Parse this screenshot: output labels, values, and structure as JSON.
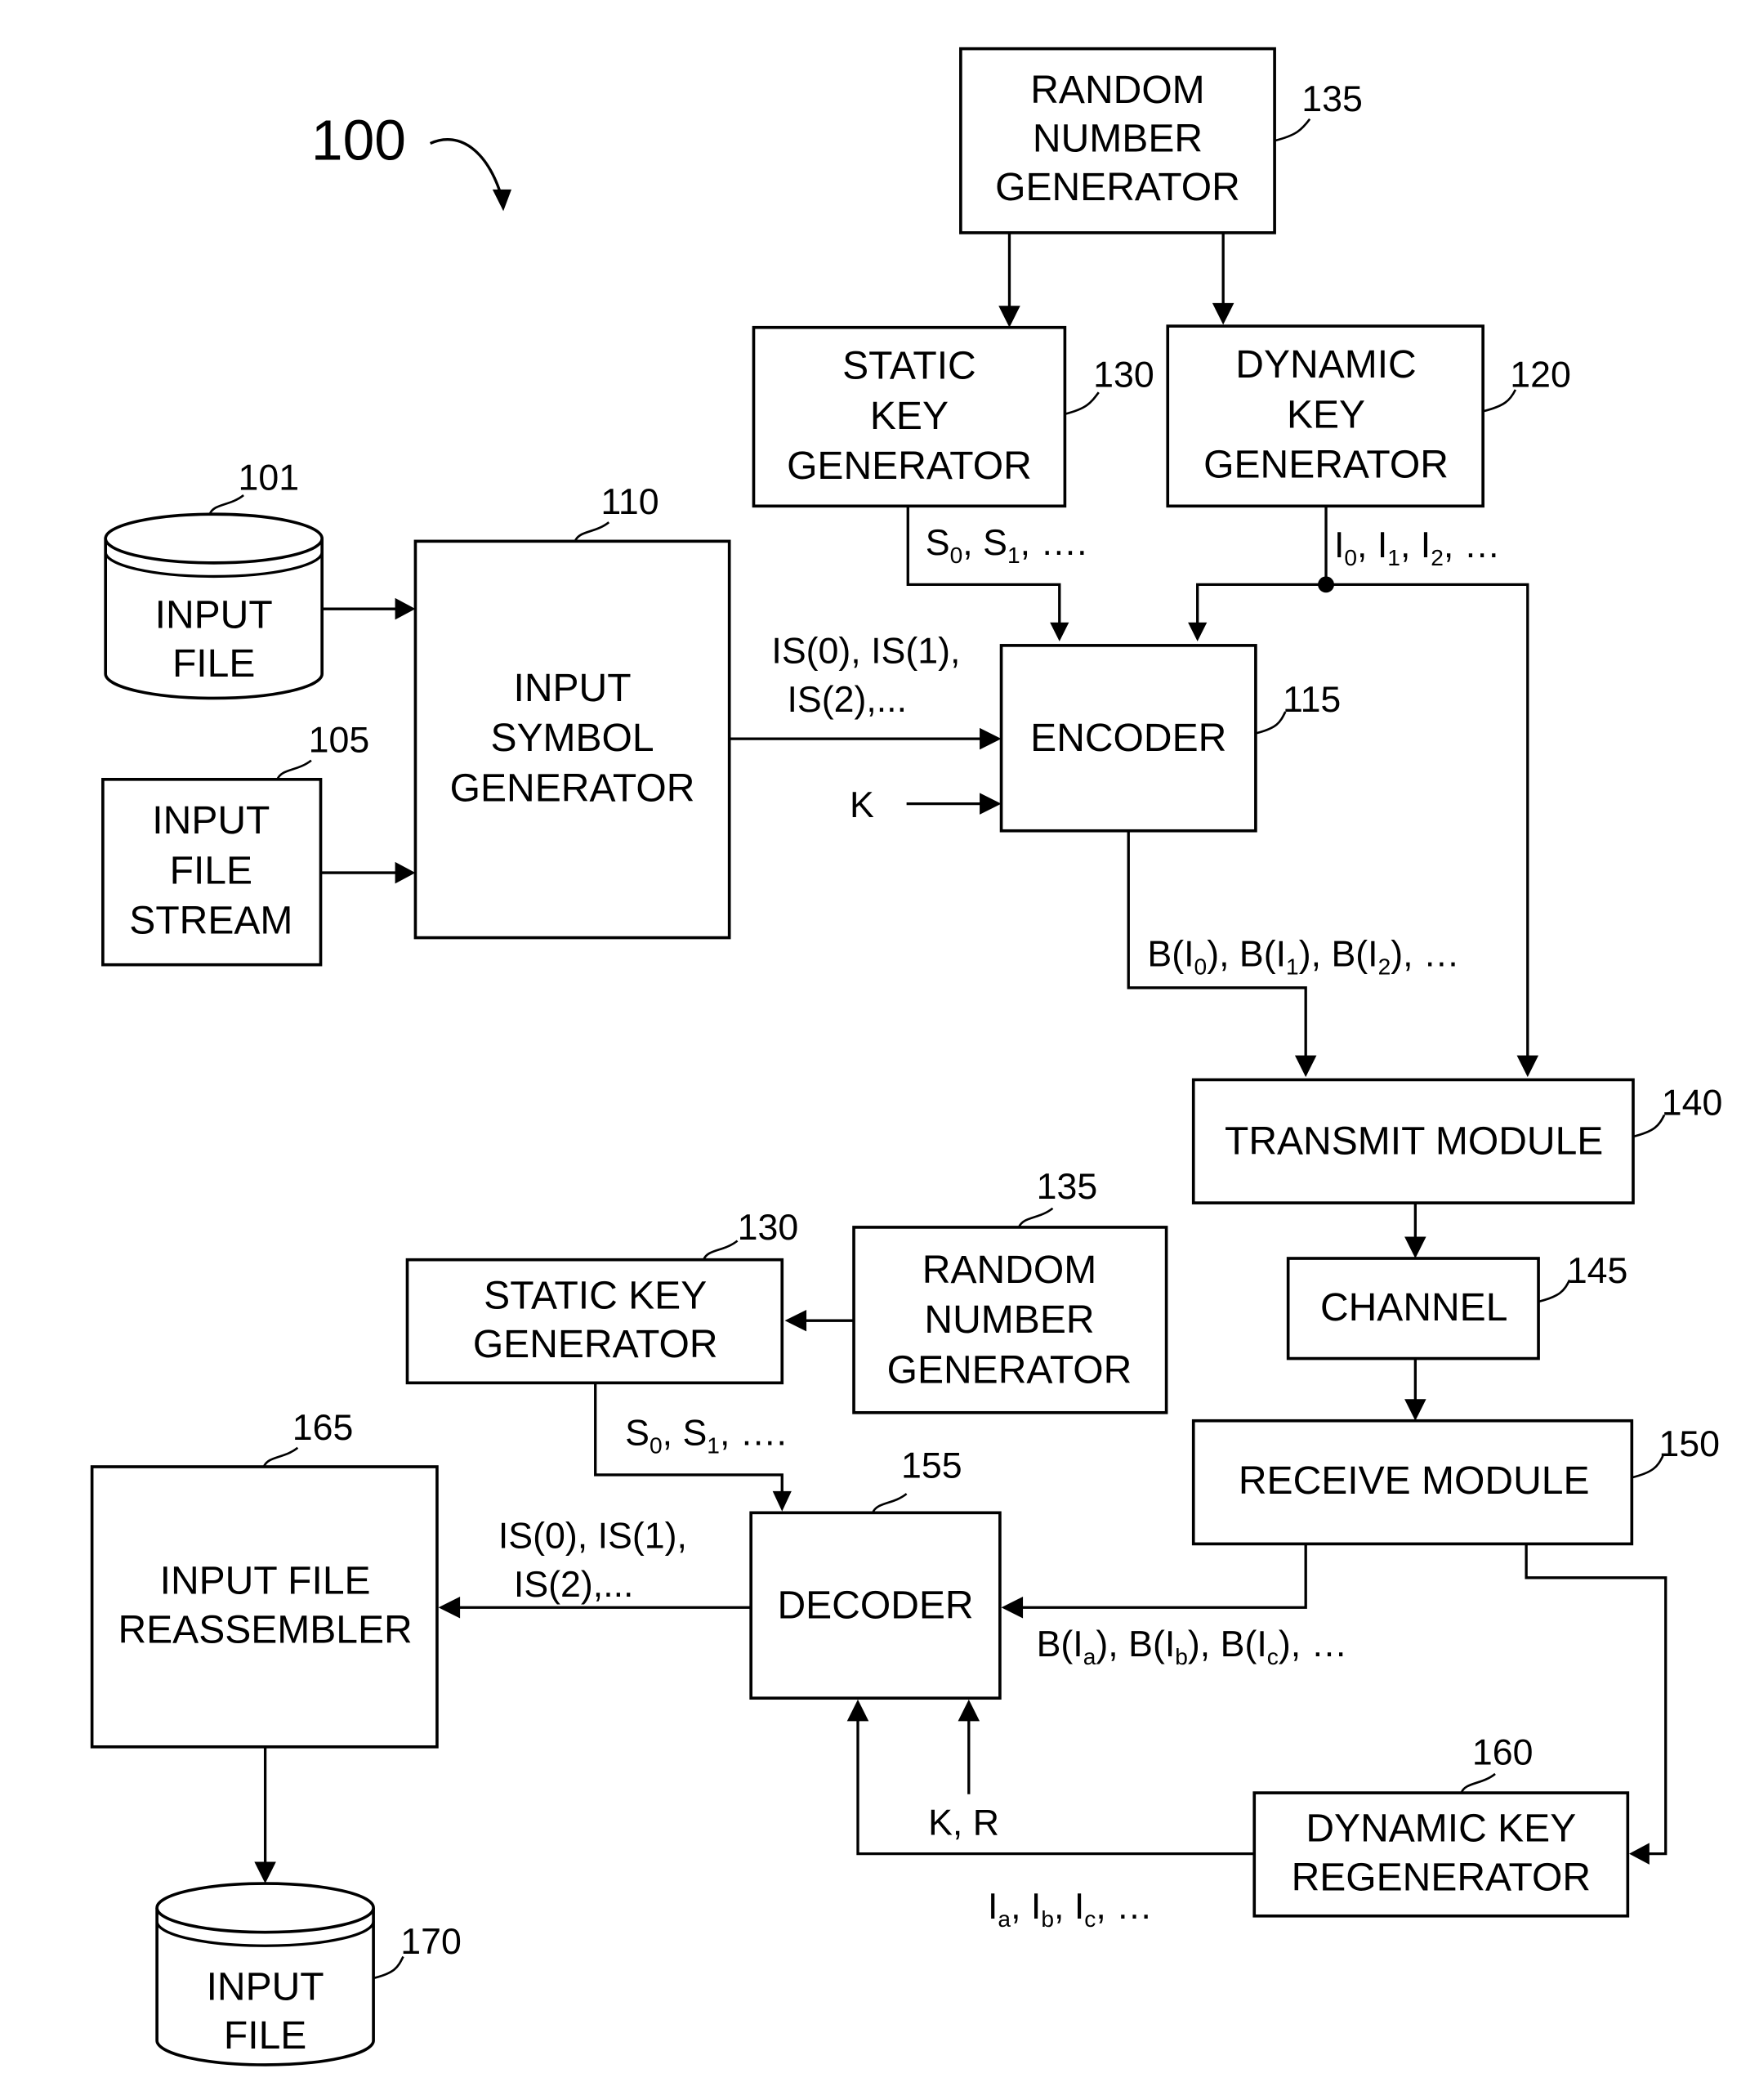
{
  "figure": {
    "number": "100"
  },
  "blocks": {
    "rng_top": {
      "lines": [
        "RANDOM",
        "NUMBER",
        "GENERATOR"
      ],
      "ref": "135"
    },
    "static_key_top": {
      "lines": [
        "STATIC",
        "KEY",
        "GENERATOR"
      ],
      "ref": "130"
    },
    "dynamic_key_top": {
      "lines": [
        "DYNAMIC",
        "KEY",
        "GENERATOR"
      ],
      "ref": "120"
    },
    "input_file_top": {
      "lines": [
        "INPUT",
        "FILE"
      ],
      "ref": "101"
    },
    "input_file_stream": {
      "lines": [
        "INPUT",
        "FILE",
        "STREAM"
      ],
      "ref": "105"
    },
    "input_symbol_generator": {
      "lines": [
        "INPUT",
        "SYMBOL",
        "GENERATOR"
      ],
      "ref": "110"
    },
    "encoder": {
      "lines": [
        "ENCODER"
      ],
      "ref": "115"
    },
    "transmit_module": {
      "lines": [
        "TRANSMIT MODULE"
      ],
      "ref": "140"
    },
    "channel": {
      "lines": [
        "CHANNEL"
      ],
      "ref": "145"
    },
    "receive_module": {
      "lines": [
        "RECEIVE MODULE"
      ],
      "ref": "150"
    },
    "static_key_bottom": {
      "lines": [
        "STATIC KEY",
        "GENERATOR"
      ],
      "ref": "130"
    },
    "rng_bottom": {
      "lines": [
        "RANDOM",
        "NUMBER",
        "GENERATOR"
      ],
      "ref": "135"
    },
    "input_file_reassembler": {
      "lines": [
        "INPUT FILE",
        "REASSEMBLER"
      ],
      "ref": "165"
    },
    "decoder": {
      "lines": [
        "DECODER"
      ],
      "ref": "155"
    },
    "dynamic_key_regenerator": {
      "lines": [
        "DYNAMIC KEY",
        "REGENERATOR"
      ],
      "ref": "160"
    },
    "input_file_bottom": {
      "lines": [
        "INPUT",
        "FILE"
      ],
      "ref": "170"
    }
  },
  "signals": {
    "static_keys_top": {
      "parts": [
        [
          "S",
          "0"
        ],
        [
          "S",
          "1"
        ]
      ],
      "tail": ", …."
    },
    "dynamic_keys_top": {
      "parts": [
        [
          "I",
          "0"
        ],
        [
          "I",
          "1"
        ],
        [
          "I",
          "2"
        ]
      ],
      "tail": ", …"
    },
    "input_symbols_top": {
      "line1": "IS(0), IS(1),",
      "line2": "IS(2),..."
    },
    "k_top": "K",
    "output_symbols_top": {
      "parts": [
        [
          "B(I",
          "0",
          ")"
        ],
        [
          "B(I",
          "1",
          ")"
        ],
        [
          "B(I",
          "2",
          ")"
        ]
      ],
      "tail": ", …"
    },
    "static_keys_bottom": {
      "parts": [
        [
          "S",
          "0"
        ],
        [
          "S",
          "1"
        ]
      ],
      "tail": ", …."
    },
    "input_symbols_bottom": {
      "line1": "IS(0), IS(1),",
      "line2": "IS(2),..."
    },
    "received_symbols": {
      "parts": [
        [
          "B(I",
          "a",
          ")"
        ],
        [
          "B(I",
          "b",
          ")"
        ],
        [
          "B(I",
          "c",
          ")"
        ]
      ],
      "tail": ",  …"
    },
    "k_r": "K, R",
    "regenerated_keys": {
      "parts": [
        [
          "I",
          "a"
        ],
        [
          "I",
          "b"
        ],
        [
          "I",
          "c"
        ]
      ],
      "tail": ",  …"
    }
  }
}
